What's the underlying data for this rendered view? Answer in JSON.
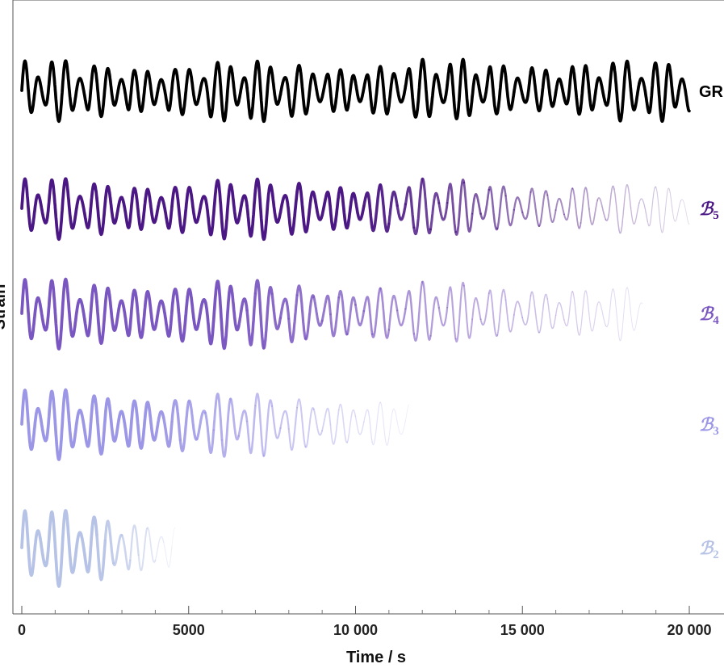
{
  "chart_data": {
    "type": "line",
    "title": "",
    "xlabel": "Time / s",
    "ylabel": "Strain",
    "xlim": [
      0,
      20000
    ],
    "x_ticks": [
      0,
      5000,
      10000,
      15000,
      20000
    ],
    "x_tick_labels": [
      "0",
      "5000",
      "10 000",
      "15 000",
      "20 000"
    ],
    "grid": false,
    "legend": "series labels at right end of each trace",
    "notes_visible": "stacked, vertically offset waveforms; B-series traces thin and fade with time",
    "series": [
      {
        "name": "GR",
        "label_main": "GR",
        "label_sub": "",
        "color": "#000000",
        "t_end": 20000,
        "fade_start": 20000,
        "fade_end": 20000,
        "period_s": 410,
        "beat_period_s": 1200,
        "amplitude_range": [
          0.3,
          1.0
        ]
      },
      {
        "name": "B5",
        "label_main": "ℬ",
        "label_sub": "5",
        "color": "#4b1784",
        "t_end": 20000,
        "fade_start": 10000,
        "fade_end": 20000,
        "period_s": 410,
        "beat_period_s": 1200,
        "amplitude_range": [
          0.3,
          1.0
        ]
      },
      {
        "name": "B4",
        "label_main": "ℬ",
        "label_sub": "4",
        "color": "#7a56c1",
        "t_end": 18600,
        "fade_start": 6000,
        "fade_end": 18600,
        "period_s": 410,
        "beat_period_s": 1200,
        "amplitude_range": [
          0.3,
          1.0
        ]
      },
      {
        "name": "B3",
        "label_main": "ℬ",
        "label_sub": "3",
        "color": "#9c96e6",
        "t_end": 11600,
        "fade_start": 3800,
        "fade_end": 11600,
        "period_s": 410,
        "beat_period_s": 1200,
        "amplitude_range": [
          0.3,
          1.0
        ]
      },
      {
        "name": "B2",
        "label_main": "ℬ",
        "label_sub": "2",
        "color": "#b6c2e6",
        "t_end": 4600,
        "fade_start": 2200,
        "fade_end": 4600,
        "period_s": 410,
        "beat_period_s": 1200,
        "amplitude_range": [
          0.3,
          1.0
        ]
      }
    ]
  }
}
